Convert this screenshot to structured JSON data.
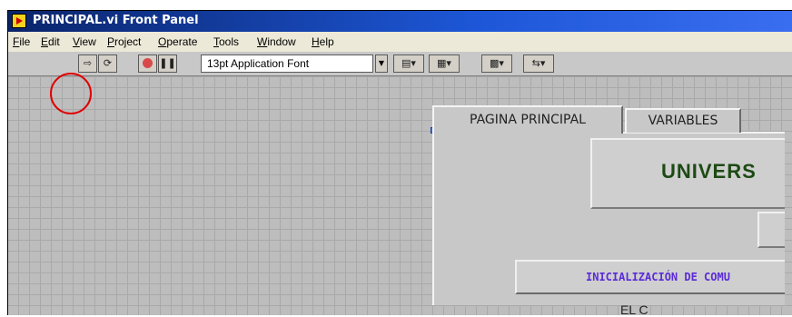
{
  "window": {
    "title": "PRINCIPAL.vi Front Panel"
  },
  "menu": [
    {
      "pre": "",
      "u": "F",
      "post": "ile"
    },
    {
      "pre": "",
      "u": "E",
      "post": "dit"
    },
    {
      "pre": "",
      "u": "V",
      "post": "iew"
    },
    {
      "pre": "",
      "u": "P",
      "post": "roject"
    },
    {
      "pre": "",
      "u": "O",
      "post": "perate"
    },
    {
      "pre": "",
      "u": "T",
      "post": "ools"
    },
    {
      "pre": "",
      "u": "W",
      "post": "indow"
    },
    {
      "pre": "",
      "u": "H",
      "post": "elp"
    }
  ],
  "toolbar": {
    "font": "13pt Application Font",
    "icons": [
      "run-arrow-icon",
      "run-continuous-icon",
      "abort-icon",
      "pause-icon",
      "align-objects-icon",
      "distribute-objects-icon",
      "resize-objects-icon",
      "reorder-icon"
    ]
  },
  "tabs": [
    {
      "label": "PAGINA PRINCIPAL",
      "active": true
    },
    {
      "label": "VARIABLES",
      "active": false
    }
  ],
  "panel": {
    "banner": "UNIVERS",
    "init_button": "INICIALIZACIÓN DE COMU",
    "partial_label": "EL C"
  },
  "colors": {
    "title_bar": "#0a246a",
    "grid": "#bdbdbd",
    "banner_text": "#1d4a14",
    "init_text": "#5a2bd8",
    "highlight_circle": "#e00000"
  }
}
